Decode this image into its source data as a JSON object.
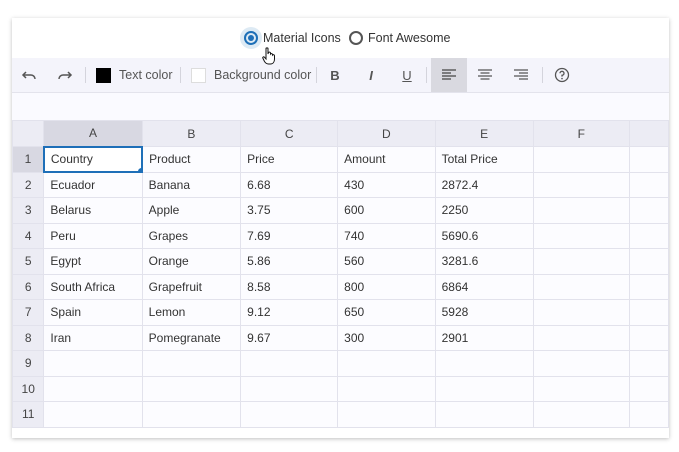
{
  "icon_options": [
    {
      "label": "Material Icons",
      "selected": true
    },
    {
      "label": "Font Awesome",
      "selected": false
    }
  ],
  "toolbar": {
    "undo_icon": "undo-icon",
    "redo_icon": "redo-icon",
    "text_color_label": "Text color",
    "text_color_value": "#000000",
    "background_color_label": "Background color",
    "background_color_value": "#ffffff",
    "bold_label": "B",
    "italic_label": "I",
    "underline_label": "U",
    "align_selected": "left",
    "help_icon": "help-icon"
  },
  "sheet": {
    "columns": [
      "A",
      "B",
      "C",
      "D",
      "E",
      "F"
    ],
    "rows": [
      "1",
      "2",
      "3",
      "4",
      "5",
      "6",
      "7",
      "8",
      "9",
      "10",
      "11"
    ],
    "selected_cell": "A1",
    "cells": [
      [
        "Country",
        "Product",
        "Price",
        "Amount",
        "Total Price",
        ""
      ],
      [
        "Ecuador",
        "Banana",
        "6.68",
        "430",
        "2872.4",
        ""
      ],
      [
        "Belarus",
        "Apple",
        "3.75",
        "600",
        "2250",
        ""
      ],
      [
        "Peru",
        "Grapes",
        "7.69",
        "740",
        "5690.6",
        ""
      ],
      [
        "Egypt",
        "Orange",
        "5.86",
        "560",
        "3281.6",
        ""
      ],
      [
        "South Africa",
        "Grapefruit",
        "8.58",
        "800",
        "6864",
        ""
      ],
      [
        "Spain",
        "Lemon",
        "9.12",
        "650",
        "5928",
        ""
      ],
      [
        "Iran",
        "Pomegranate",
        "9.67",
        "300",
        "2901",
        ""
      ],
      [
        "",
        "",
        "",
        "",
        "",
        ""
      ],
      [
        "",
        "",
        "",
        "",
        "",
        ""
      ],
      [
        "",
        "",
        "",
        "",
        "",
        ""
      ]
    ]
  },
  "colors": {
    "accent": "#1e6fb8",
    "header_bg": "#ececf4",
    "toolbar_bg": "#f4f4fb"
  }
}
